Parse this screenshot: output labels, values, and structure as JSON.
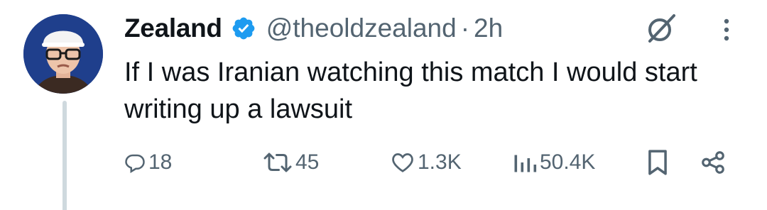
{
  "tweet": {
    "display_name": "Zealand",
    "handle": "@theoldzealand",
    "separator": "·",
    "time": "2h",
    "text": "If I was Iranian watching this match I would start writing up a lawsuit",
    "verified_color": "#1d9bf0",
    "icons": {
      "verified": "verified-badge-icon",
      "grok": "grok-icon",
      "more": "more-dots-icon"
    }
  },
  "actions": {
    "replies": {
      "icon": "reply-icon",
      "count": "18"
    },
    "reposts": {
      "icon": "repost-icon",
      "count": "45"
    },
    "likes": {
      "icon": "heart-icon",
      "count": "1.3K"
    },
    "views": {
      "icon": "views-icon",
      "count": "50.4K"
    },
    "bookmark": {
      "icon": "bookmark-icon"
    },
    "share": {
      "icon": "share-icon"
    }
  },
  "colors": {
    "text": "#0f1419",
    "secondary": "#536471",
    "thread_line": "#cfd9de"
  }
}
